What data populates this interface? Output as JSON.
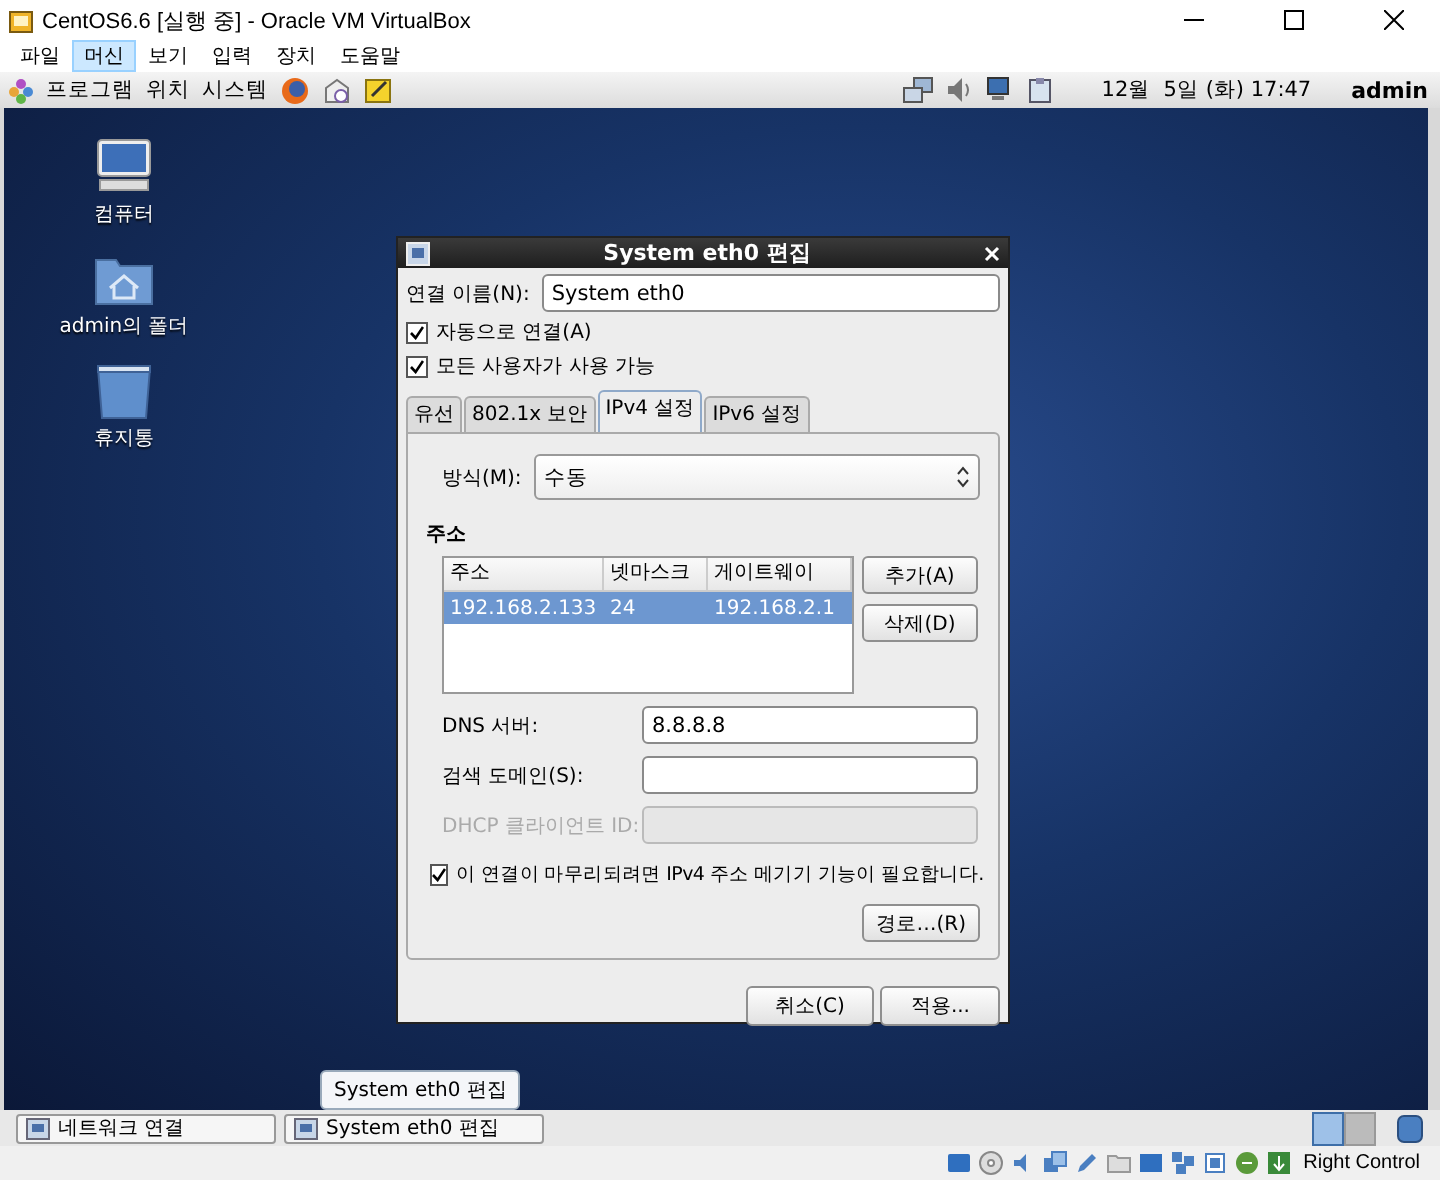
{
  "host_window": {
    "title": "CentOS6.6 [실행 중] - Oracle VM VirtualBox"
  },
  "host_menu": [
    {
      "label": "파일",
      "selected": false
    },
    {
      "label": "머신",
      "selected": true
    },
    {
      "label": "보기",
      "selected": false
    },
    {
      "label": "입력",
      "selected": false
    },
    {
      "label": "장치",
      "selected": false
    },
    {
      "label": "도움말",
      "selected": false
    }
  ],
  "top_panel": {
    "menus": [
      "프로그램",
      "위치",
      "시스템"
    ],
    "clock": "12월  5일 (화) 17:47",
    "user": "admin"
  },
  "desktop_icons": [
    {
      "kind": "computer",
      "label": "컴퓨터"
    },
    {
      "kind": "home",
      "label": "admin의 폴더"
    },
    {
      "kind": "trash",
      "label": "휴지통"
    }
  ],
  "dialog": {
    "title": "System eth0 편집",
    "name_label": "연결 이름(N):",
    "name_value": "System eth0",
    "options": [
      {
        "label": "자동으로 연결(A)",
        "checked": true
      },
      {
        "label": "모든 사용자가 사용 가능",
        "checked": true
      }
    ],
    "tabs": [
      {
        "label": "유선",
        "selected": false
      },
      {
        "label": "802.1x 보안",
        "selected": false
      },
      {
        "label": "IPv4 설정",
        "selected": true
      },
      {
        "label": "IPv6 설정",
        "selected": false
      }
    ],
    "method_label": "방식(M):",
    "method_value": "수동",
    "address_heading": "주소",
    "address_table": {
      "columns": [
        "주소",
        "넷마스크",
        "게이트웨이"
      ],
      "rows": [
        {
          "cells": [
            "192.168.2.133",
            "24",
            "192.168.2.1"
          ],
          "selected": true
        }
      ]
    },
    "add_button": "추가(A)",
    "delete_button": "삭제(D)",
    "fields": [
      {
        "label": "DNS 서버:",
        "value": "8.8.8.8",
        "disabled": false
      },
      {
        "label": "검색 도메인(S):",
        "disabled": false
      },
      {
        "label": "DHCP 클라이언트 ID:",
        "disabled": true
      }
    ],
    "require_ipv4": {
      "label": "이 연결이 마무리되려면 IPv4 주소 메기기 기능이 필요합니다.",
      "checked": true
    },
    "routes_button": "경로…(R)",
    "cancel_button": "취소(C)",
    "apply_button": "적용..."
  },
  "tooltip": "System eth0 편집",
  "taskbar": [
    {
      "label": "네트워크 연결"
    },
    {
      "label": "System eth0 편집"
    }
  ],
  "workspaces": [
    {
      "selected": true
    },
    {
      "selected": false
    }
  ],
  "status_bar": {
    "host_key": "Right Control"
  }
}
